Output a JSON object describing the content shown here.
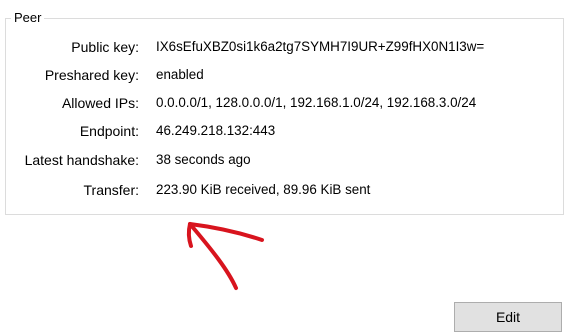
{
  "peer": {
    "title": "Peer",
    "fields": [
      {
        "label": "Public key:",
        "value": "IX6sEfuXBZ0si1k6a2tg7SYMH7I9UR+Z99fHX0N1I3w="
      },
      {
        "label": "Preshared key:",
        "value": "enabled"
      },
      {
        "label": "Allowed IPs:",
        "value": "0.0.0.0/1, 128.0.0.0/1, 192.168.1.0/24, 192.168.3.0/24"
      },
      {
        "label": "Endpoint:",
        "value": "46.249.218.132:443"
      },
      {
        "label": "Latest handshake:",
        "value": "38 seconds ago"
      },
      {
        "label": "Transfer:",
        "value": "223.90 KiB received, 89.96 KiB sent"
      }
    ]
  },
  "annotation": {
    "icon": "hand-drawn-arrow-up-left",
    "color": "#d8141e"
  },
  "actions": {
    "edit_label": "Edit"
  }
}
